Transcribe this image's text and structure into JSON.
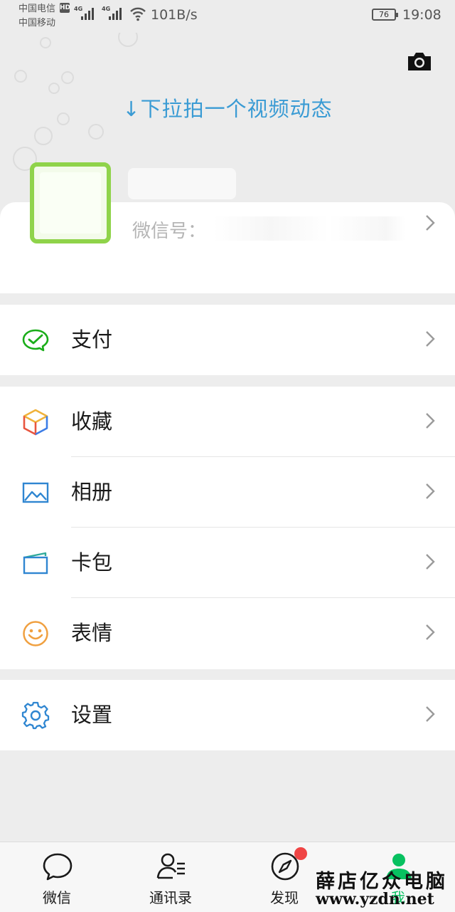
{
  "status_bar": {
    "carrier_1": "中国电信",
    "carrier_1_badge": "HD",
    "carrier_2": "中国移动",
    "signal_1_label": "4G",
    "signal_2_label": "4G",
    "net_speed": "101B/s",
    "battery_level": "76",
    "time": "19:08"
  },
  "header": {
    "pull_hint": "↓下拉拍一个视频动态",
    "camera_icon": "camera-icon"
  },
  "profile": {
    "wxid_label": "微信号："
  },
  "menu": {
    "pay": {
      "label": "支付",
      "icon": "wechat-pay-icon"
    },
    "favorites": {
      "label": "收藏",
      "icon": "favorites-cube-icon"
    },
    "album": {
      "label": "相册",
      "icon": "album-icon"
    },
    "cards": {
      "label": "卡包",
      "icon": "card-wallet-icon"
    },
    "stickers": {
      "label": "表情",
      "icon": "smiley-icon"
    },
    "settings": {
      "label": "设置",
      "icon": "gear-icon"
    }
  },
  "tabbar": {
    "chats": "微信",
    "contacts": "通讯录",
    "discover": "发现",
    "me": "我"
  },
  "watermark": {
    "text": "薛店亿众电脑",
    "url": "www.yzdn.net"
  },
  "colors": {
    "accent_blue": "#3a9bd4",
    "wechat_green": "#07c160",
    "badge_red": "#f04545"
  }
}
